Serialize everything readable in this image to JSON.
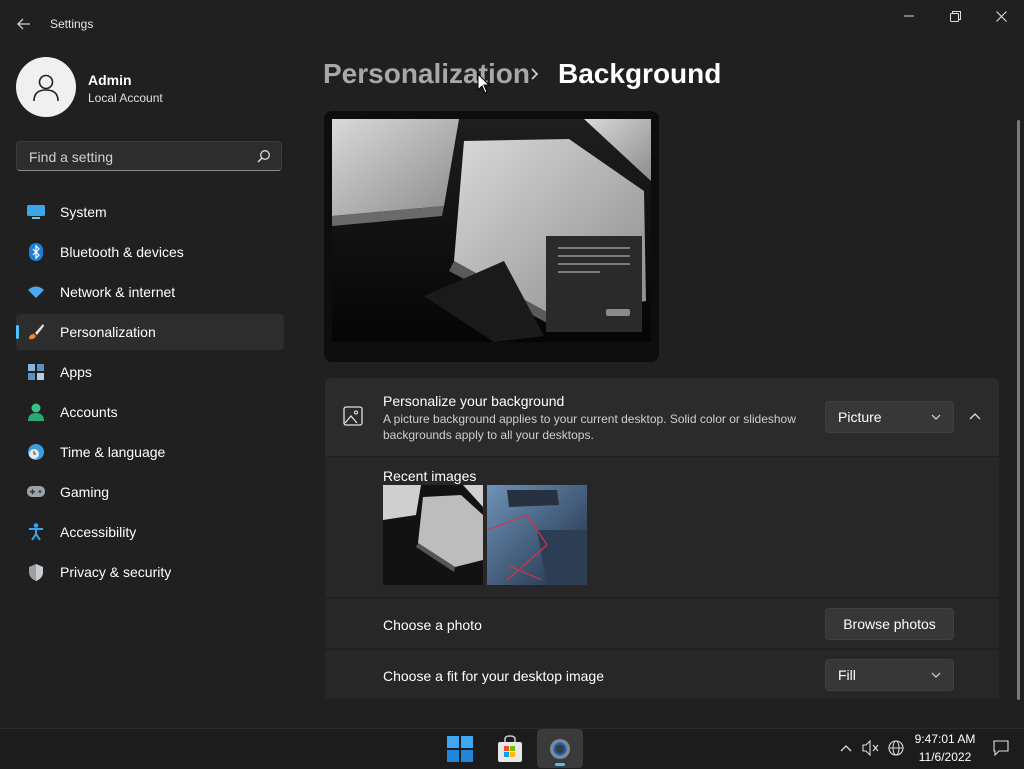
{
  "window": {
    "title": "Settings",
    "minimize_icon": "minimize-icon",
    "maximize_icon": "restore-icon",
    "close_icon": "close-icon"
  },
  "profile": {
    "name": "Admin",
    "account_type": "Local Account"
  },
  "search": {
    "placeholder": "Find a setting"
  },
  "sidebar": {
    "items": [
      {
        "label": "System",
        "icon": "monitor-icon"
      },
      {
        "label": "Bluetooth & devices",
        "icon": "bluetooth-icon"
      },
      {
        "label": "Network & internet",
        "icon": "wifi-icon"
      },
      {
        "label": "Personalization",
        "icon": "brush-icon",
        "active": true
      },
      {
        "label": "Apps",
        "icon": "apps-icon"
      },
      {
        "label": "Accounts",
        "icon": "person-icon"
      },
      {
        "label": "Time & language",
        "icon": "clock-globe-icon"
      },
      {
        "label": "Gaming",
        "icon": "gamepad-icon"
      },
      {
        "label": "Accessibility",
        "icon": "accessibility-icon"
      },
      {
        "label": "Privacy & security",
        "icon": "shield-icon"
      }
    ]
  },
  "header": {
    "parent": "Personalization",
    "current": "Background"
  },
  "background": {
    "title": "Personalize your background",
    "description": "A picture background applies to your current desktop. Solid color or slideshow backgrounds apply to all your desktops.",
    "type_selected": "Picture",
    "recent_label": "Recent images",
    "choose_photo_label": "Choose a photo",
    "browse_button": "Browse photos",
    "fit_label": "Choose a fit for your desktop image",
    "fit_selected": "Fill"
  },
  "taskbar": {
    "apps": [
      "windows-start-icon",
      "microsoft-store-icon",
      "settings-gear-icon"
    ],
    "time": "9:47:01 AM",
    "date": "11/6/2022"
  },
  "colors": {
    "accent": "#4cc2ff",
    "background": "#202020",
    "card": "#2b2b2b"
  }
}
